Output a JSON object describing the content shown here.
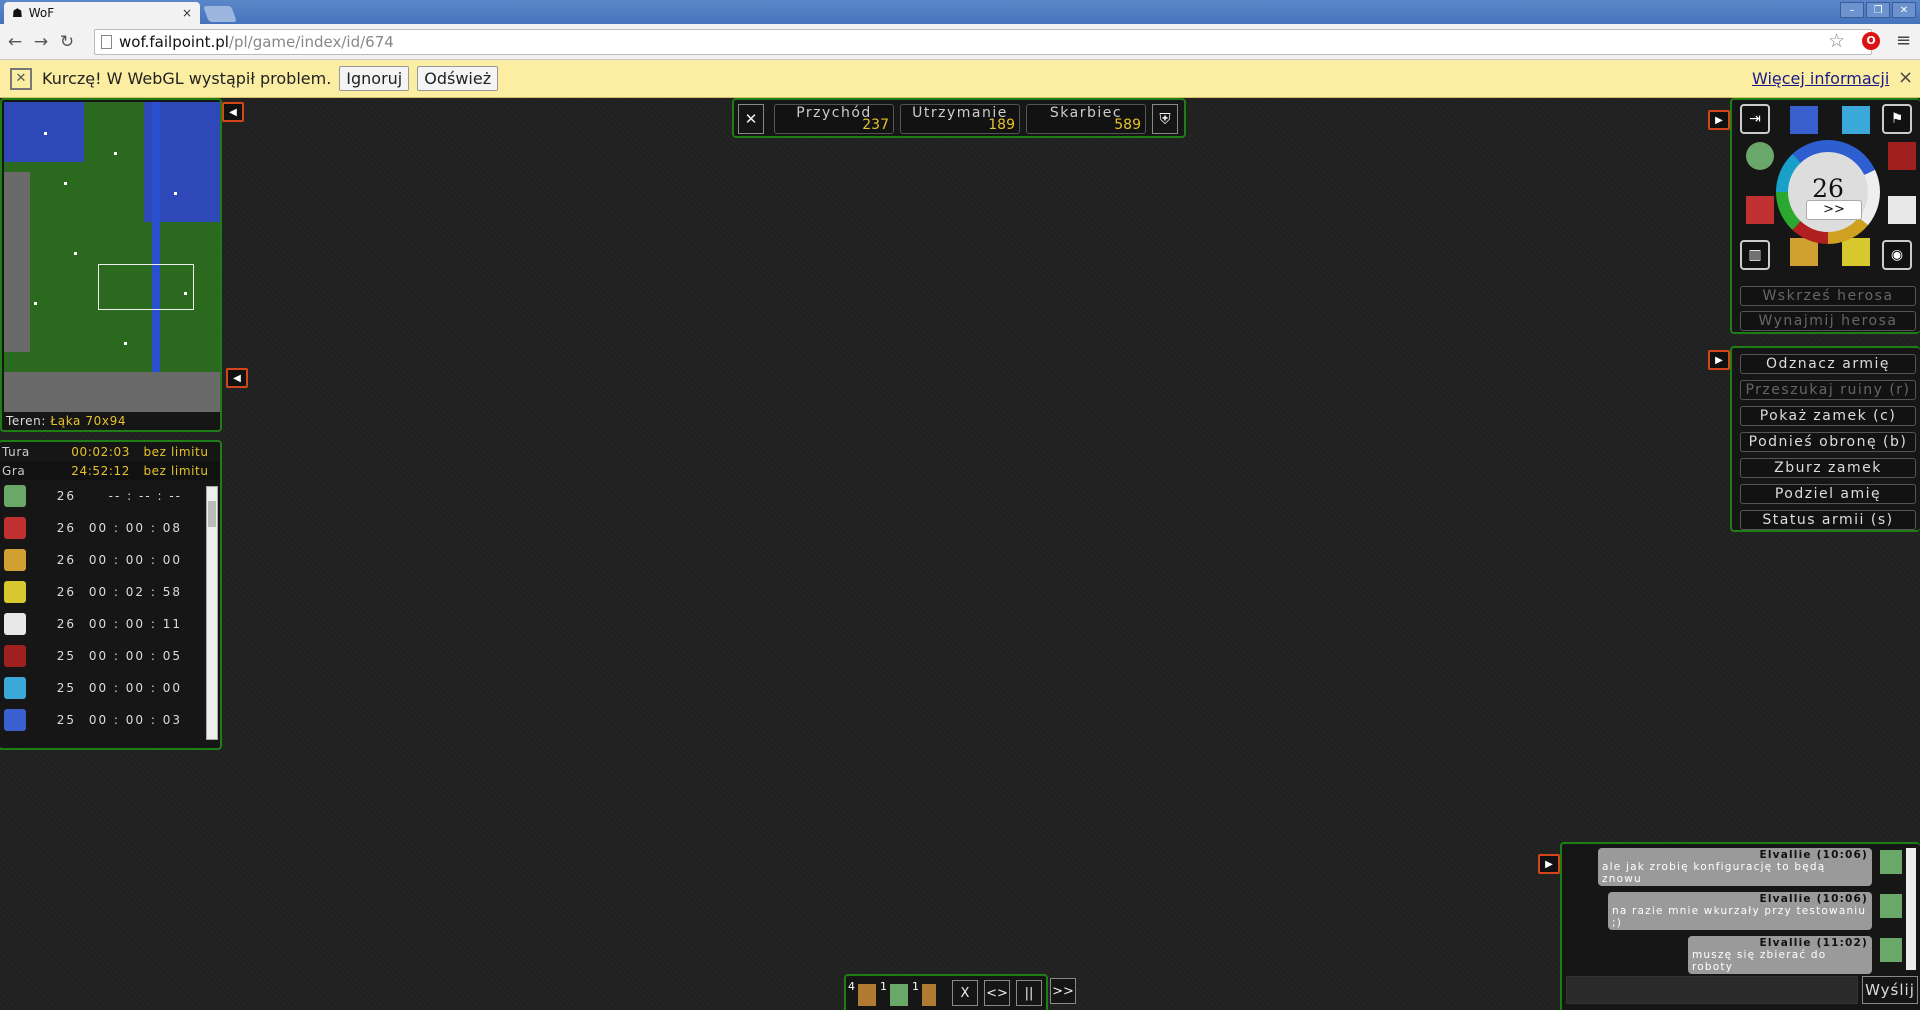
{
  "browser": {
    "tab_title": "WoF",
    "tab_close": "×",
    "url_host": "wof.failpoint.pl",
    "url_path": "/pl/game/index/id/674",
    "back": "←",
    "forward": "→",
    "reload": "↻",
    "star": "☆",
    "menu": "≡"
  },
  "infobar": {
    "message": "Kurczę! W WebGL wystąpił problem.",
    "ignore": "Ignoruj",
    "refresh": "Odśwież",
    "more": "Więcej informacji",
    "close": "×"
  },
  "minimap": {
    "terrain_label": "Teren:",
    "terrain_value": "Łąka 70x94",
    "collapse": "◀"
  },
  "timers": {
    "collapse": "◀",
    "rows": [
      {
        "label": "Tura",
        "time": "00:02:03",
        "limit": "bez limitu"
      },
      {
        "label": "Gra",
        "time": "24:52:12",
        "limit": "bez limitu"
      }
    ],
    "players": [
      {
        "color": "#6aa86a",
        "turn": "26",
        "time": "-- : -- : --"
      },
      {
        "color": "#c03030",
        "turn": "26",
        "time": "00 : 00 : 08"
      },
      {
        "color": "#d0a030",
        "turn": "26",
        "time": "00 : 00 : 00"
      },
      {
        "color": "#d8c830",
        "turn": "26",
        "time": "00 : 02 : 58"
      },
      {
        "color": "#e8e8e8",
        "turn": "26",
        "time": "00 : 00 : 11"
      },
      {
        "color": "#a02020",
        "turn": "25",
        "time": "00 : 00 : 05"
      },
      {
        "color": "#3aa8d8",
        "turn": "25",
        "time": "00 : 00 : 00"
      },
      {
        "color": "#3a60d0",
        "turn": "25",
        "time": "00 : 00 : 03"
      }
    ]
  },
  "topbar": {
    "left_icon": "✕",
    "right_icon": "⛨",
    "stats": [
      {
        "label": "Przychód",
        "value": "237"
      },
      {
        "label": "Utrzymanie",
        "value": "189"
      },
      {
        "label": "Skarbiec",
        "value": "589"
      }
    ]
  },
  "players_panel": {
    "expand": "▶",
    "turn": "26",
    "next": ">>",
    "revive": "Wskrześ herosa",
    "hire": "Wynajmij herosa"
  },
  "actions": {
    "expand": "▶",
    "buttons": [
      "Odznacz armię",
      "Przeszukaj ruiny (r)",
      "Pokaż zamek (c)",
      "Podnieś obronę (b)",
      "Zburz zamek",
      "Podziel amię",
      "Status armii (s)"
    ]
  },
  "chat": {
    "expand": "▶",
    "send": "Wyślij",
    "messages": [
      {
        "author": "Elvallie (10:06)",
        "text": "ale jak zrobię konfigurację to będą znowu"
      },
      {
        "author": "Elvallie (10:06)",
        "text": "na razie mnie wkurzały przy testowaniu ;)"
      },
      {
        "author": "Elvallie (11:02)",
        "text": "muszę się zbierać do roboty"
      }
    ]
  },
  "bottombar": {
    "units": [
      {
        "count": "4"
      },
      {
        "count": "1"
      },
      {
        "count": "1"
      }
    ],
    "buttons": [
      "X",
      "<>",
      "||",
      ">>"
    ]
  }
}
